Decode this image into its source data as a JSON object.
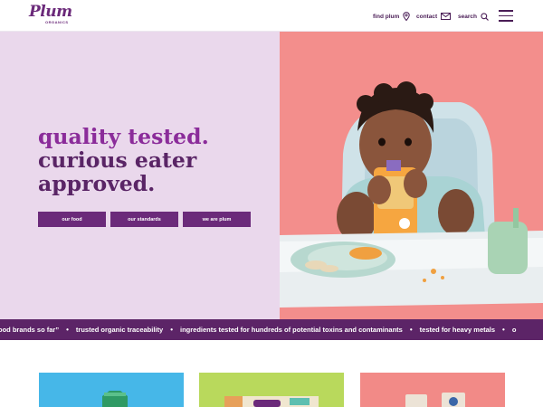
{
  "header": {
    "logo_text": "Plum",
    "logo_subtext": "ORGANICS",
    "nav": {
      "find_plum": "find plum",
      "contact": "contact",
      "search": "search"
    }
  },
  "hero": {
    "title_line1": "quality tested.",
    "title_line2": "curious eater",
    "title_line3": "approved.",
    "buttons": {
      "our_food": "our food",
      "our_standards": "our standards",
      "we_are_plum": "we are plum"
    }
  },
  "ticker": {
    "items": [
      "ood brands so far”",
      "trusted organic traceability",
      "ingredients tested for hundreds of potential toxins and contaminants",
      "tested for heavy metals",
      "o"
    ]
  },
  "colors": {
    "brand_purple": "#6b2a7a",
    "title_purple": "#8b2c9a",
    "hero_left_bg": "#ead8ec",
    "hero_right_bg": "#f38e8c",
    "ticker_bg": "#5c2467",
    "card_blue": "#46b7e8",
    "card_green": "#b9d95c",
    "card_pink": "#f28a87"
  }
}
